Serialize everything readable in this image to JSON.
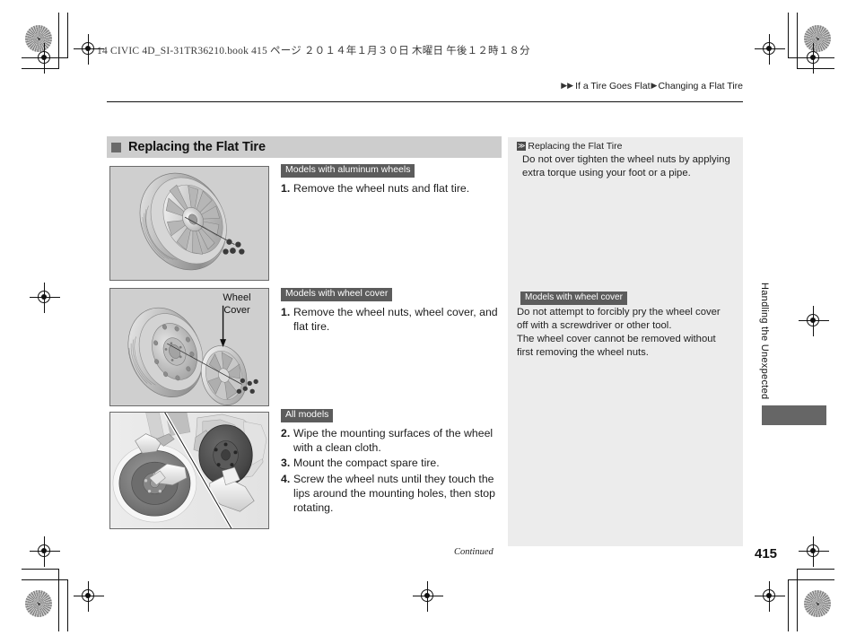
{
  "slug": "14 CIVIC 4D_SI-31TR36210.book   415 ページ   ２０１４年１月３０日   木曜日   午後１２時１８分",
  "running_head": {
    "marker1": "▶",
    "marker2": "▶",
    "part1": "If a Tire Goes Flat",
    "marker3": "▶",
    "part2": "Changing a Flat Tire"
  },
  "section": {
    "title": "Replacing the Flat Tire"
  },
  "figures": [
    {
      "name": "aluminum-wheel-exploded",
      "caption": ""
    },
    {
      "name": "steel-wheel-with-cover-exploded",
      "caption": "Wheel\nCover",
      "caption_line1": "Wheel",
      "caption_line2": "Cover"
    },
    {
      "name": "wiping-mounting-surfaces",
      "caption": ""
    }
  ],
  "instruction_blocks": [
    {
      "tag": "Models with aluminum wheels",
      "steps": [
        {
          "num": "1.",
          "text": "Remove the wheel nuts and flat tire."
        }
      ]
    },
    {
      "tag": "Models with wheel cover",
      "steps": [
        {
          "num": "1.",
          "text": "Remove the wheel nuts, wheel cover, and flat tire."
        }
      ]
    },
    {
      "tag": "All models",
      "steps": [
        {
          "num": "2.",
          "text": "Wipe the mounting surfaces of the wheel with a clean cloth."
        },
        {
          "num": "3.",
          "text": "Mount the compact spare tire."
        },
        {
          "num": "4.",
          "text": "Screw the wheel nuts until they touch the lips around the mounting holes, then stop rotating."
        }
      ]
    }
  ],
  "sidebar": {
    "note1": {
      "marker": "≫",
      "heading": "Replacing the Flat Tire",
      "body": "Do not over tighten the wheel nuts by applying extra torque using your foot or a pipe."
    },
    "note2": {
      "tag": "Models with wheel cover",
      "body_line1": "Do not attempt to forcibly pry the wheel cover off with a screwdriver or other tool.",
      "body_line2": "The wheel cover cannot be removed without first removing the wheel nuts."
    }
  },
  "vertical_tab": {
    "label": "Handling the Unexpected"
  },
  "footer": {
    "continued": "Continued",
    "page_number": "415"
  },
  "colors": {
    "section_band": "#cdcdcd",
    "tag_background": "#5c5c5c",
    "sidebar_background": "#ececec",
    "tab_block": "#666666",
    "figure_background": "#cfcfcf"
  }
}
